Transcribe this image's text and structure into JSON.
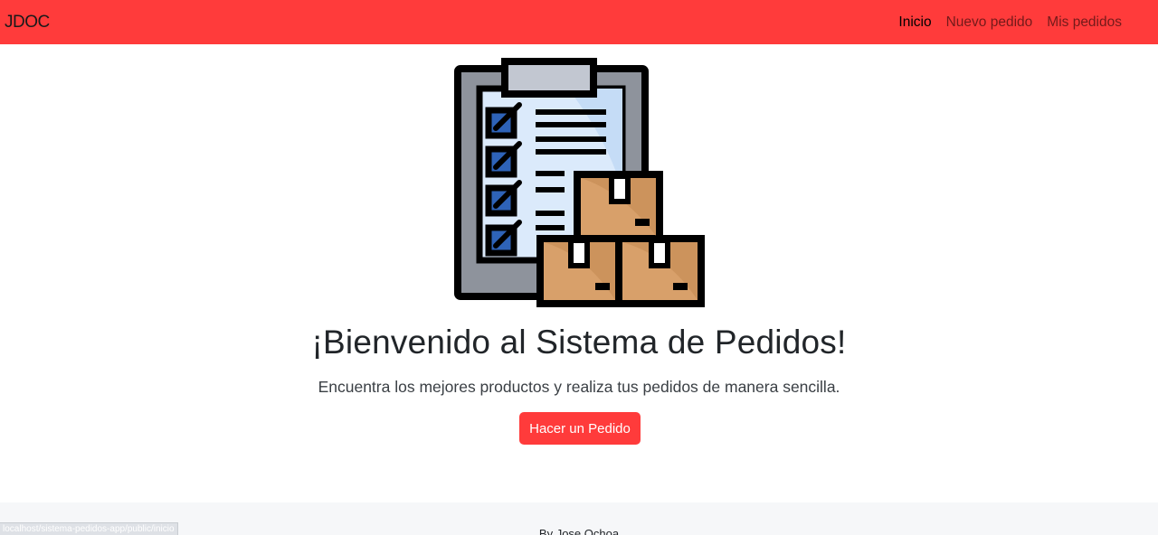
{
  "navbar": {
    "brand": "JDOC",
    "links": [
      {
        "label": "Inicio",
        "active": true
      },
      {
        "label": "Nuevo pedido",
        "active": false
      },
      {
        "label": "Mis pedidos",
        "active": false
      }
    ],
    "color": "#ff3b3b"
  },
  "hero": {
    "illustration": "clipboard-checklist-boxes-icon",
    "title": "¡Bienvenido al Sistema de Pedidos!",
    "subtitle": "Encuentra los mejores productos y realiza tus pedidos de manera sencilla.",
    "cta_label": "Hacer un Pedido"
  },
  "footer": {
    "text": "By Jose Ochoa"
  },
  "status_bar": {
    "url": "localhost/sistema-pedidos-app/public/inicio"
  }
}
